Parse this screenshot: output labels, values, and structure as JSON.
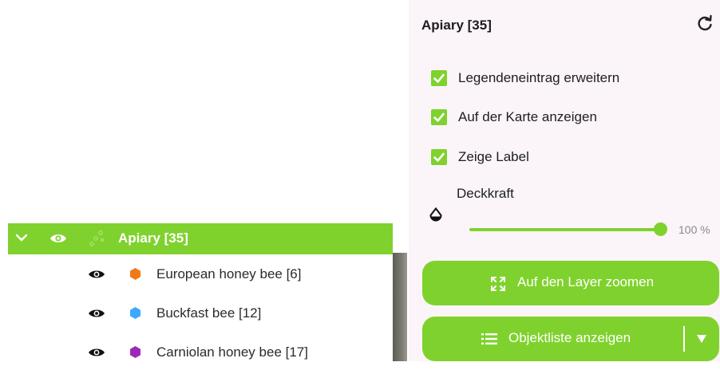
{
  "layer_tree": {
    "group": {
      "title": "Apiary [35]"
    },
    "sublayers": [
      {
        "name": "European honey bee [6]",
        "color": "#f07a1a"
      },
      {
        "name": "Buckfast bee [12]",
        "color": "#3ea8ff"
      },
      {
        "name": "Carniolan honey bee [17]",
        "color": "#9c2ab8"
      }
    ]
  },
  "panel": {
    "title": "Apiary [35]",
    "checkboxes": [
      {
        "label": "Legendeneintrag erweitern",
        "checked": true
      },
      {
        "label": "Auf der Karte anzeigen",
        "checked": true
      },
      {
        "label": "Zeige Label",
        "checked": true
      }
    ],
    "opacity": {
      "label": "Deckkraft",
      "value_text": "100 %",
      "value": 100
    },
    "zoom_button": {
      "label": "Auf den Layer zoomen"
    },
    "list_button": {
      "label": "Objektliste anzeigen"
    }
  },
  "colors": {
    "accent": "#7fd22d",
    "panel_bg": "#fbf4f9"
  }
}
